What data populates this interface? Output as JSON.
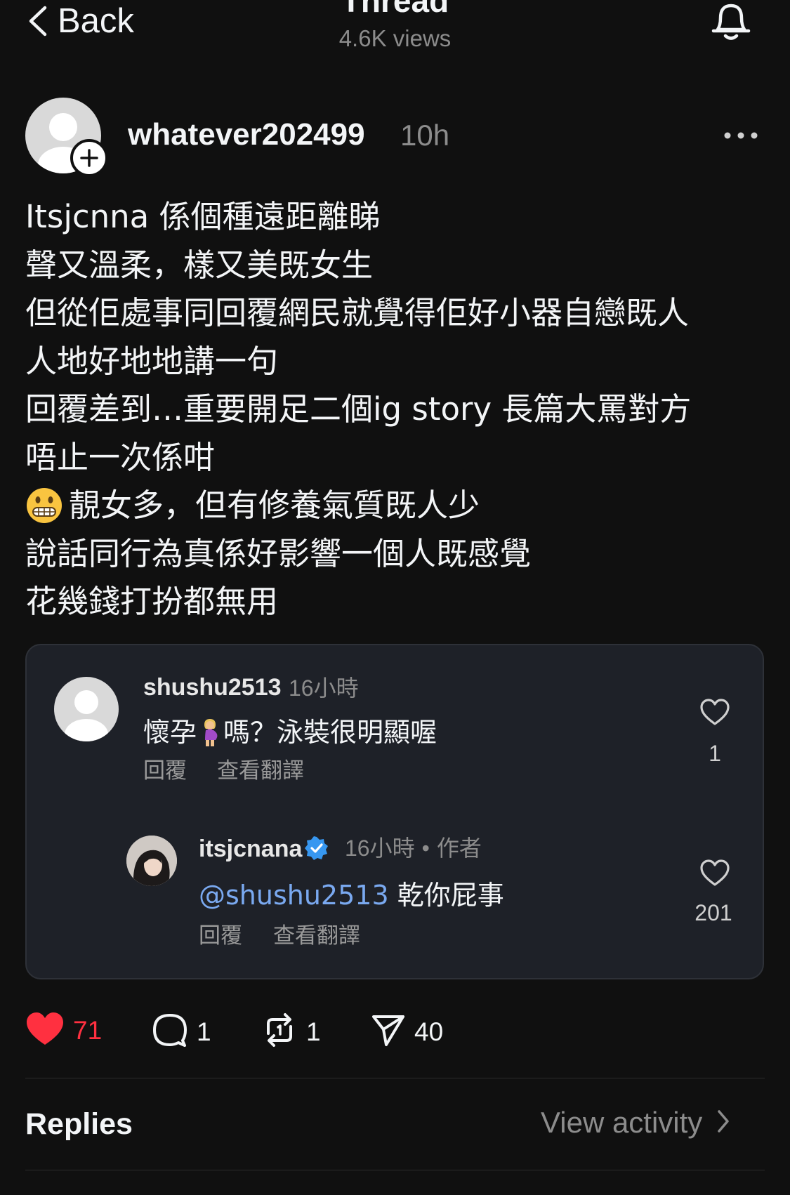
{
  "nav": {
    "back_label": "Back",
    "title": "Thread",
    "views": "4.6K views"
  },
  "post": {
    "username": "whatever202499",
    "time": "10h",
    "lines": [
      "Itsjcnna 係個種遠距離睇",
      "聲又溫柔，樣又美既女生",
      "但從佢處事同回覆網民就覺得佢好小器自戀既人",
      "人地好地地講一句",
      "回覆差到…重要開足二個ig story 長篇大罵對方",
      "唔止一次係咁",
      "靚女多，但有修養氣質既人少",
      "說話同行為真係好影響一個人既感覺",
      "花幾錢打扮都無用"
    ],
    "emoji_line_index": 6,
    "emoji_icon": "grimacing-face-emoji"
  },
  "comments": [
    {
      "username": "shushu2513",
      "time": "16小時",
      "text_before": "懷孕",
      "text_emoji": "pregnant-woman-emoji",
      "text_after": "嗎？泳裝很明顯喔",
      "reply_label": "回覆",
      "translate_label": "查看翻譯",
      "likes": "1"
    },
    {
      "username": "itsjcnana",
      "verified": true,
      "time": "16小時",
      "separator": "•",
      "author_label": "作者",
      "mention": "@shushu2513",
      "text": " 乾你屁事",
      "reply_label": "回覆",
      "translate_label": "查看翻譯",
      "likes": "201"
    }
  ],
  "actions": {
    "likes": "71",
    "liked": true,
    "comments": "1",
    "reposts": "1",
    "shares": "40"
  },
  "replies": {
    "title": "Replies",
    "view_activity": "View activity"
  },
  "colors": {
    "background": "#101010",
    "card": "#1e2128",
    "like_red": "#ff3040",
    "verified_blue": "#3797f0",
    "mention_blue": "#7aa9f0",
    "muted": "#8c8c8c"
  }
}
